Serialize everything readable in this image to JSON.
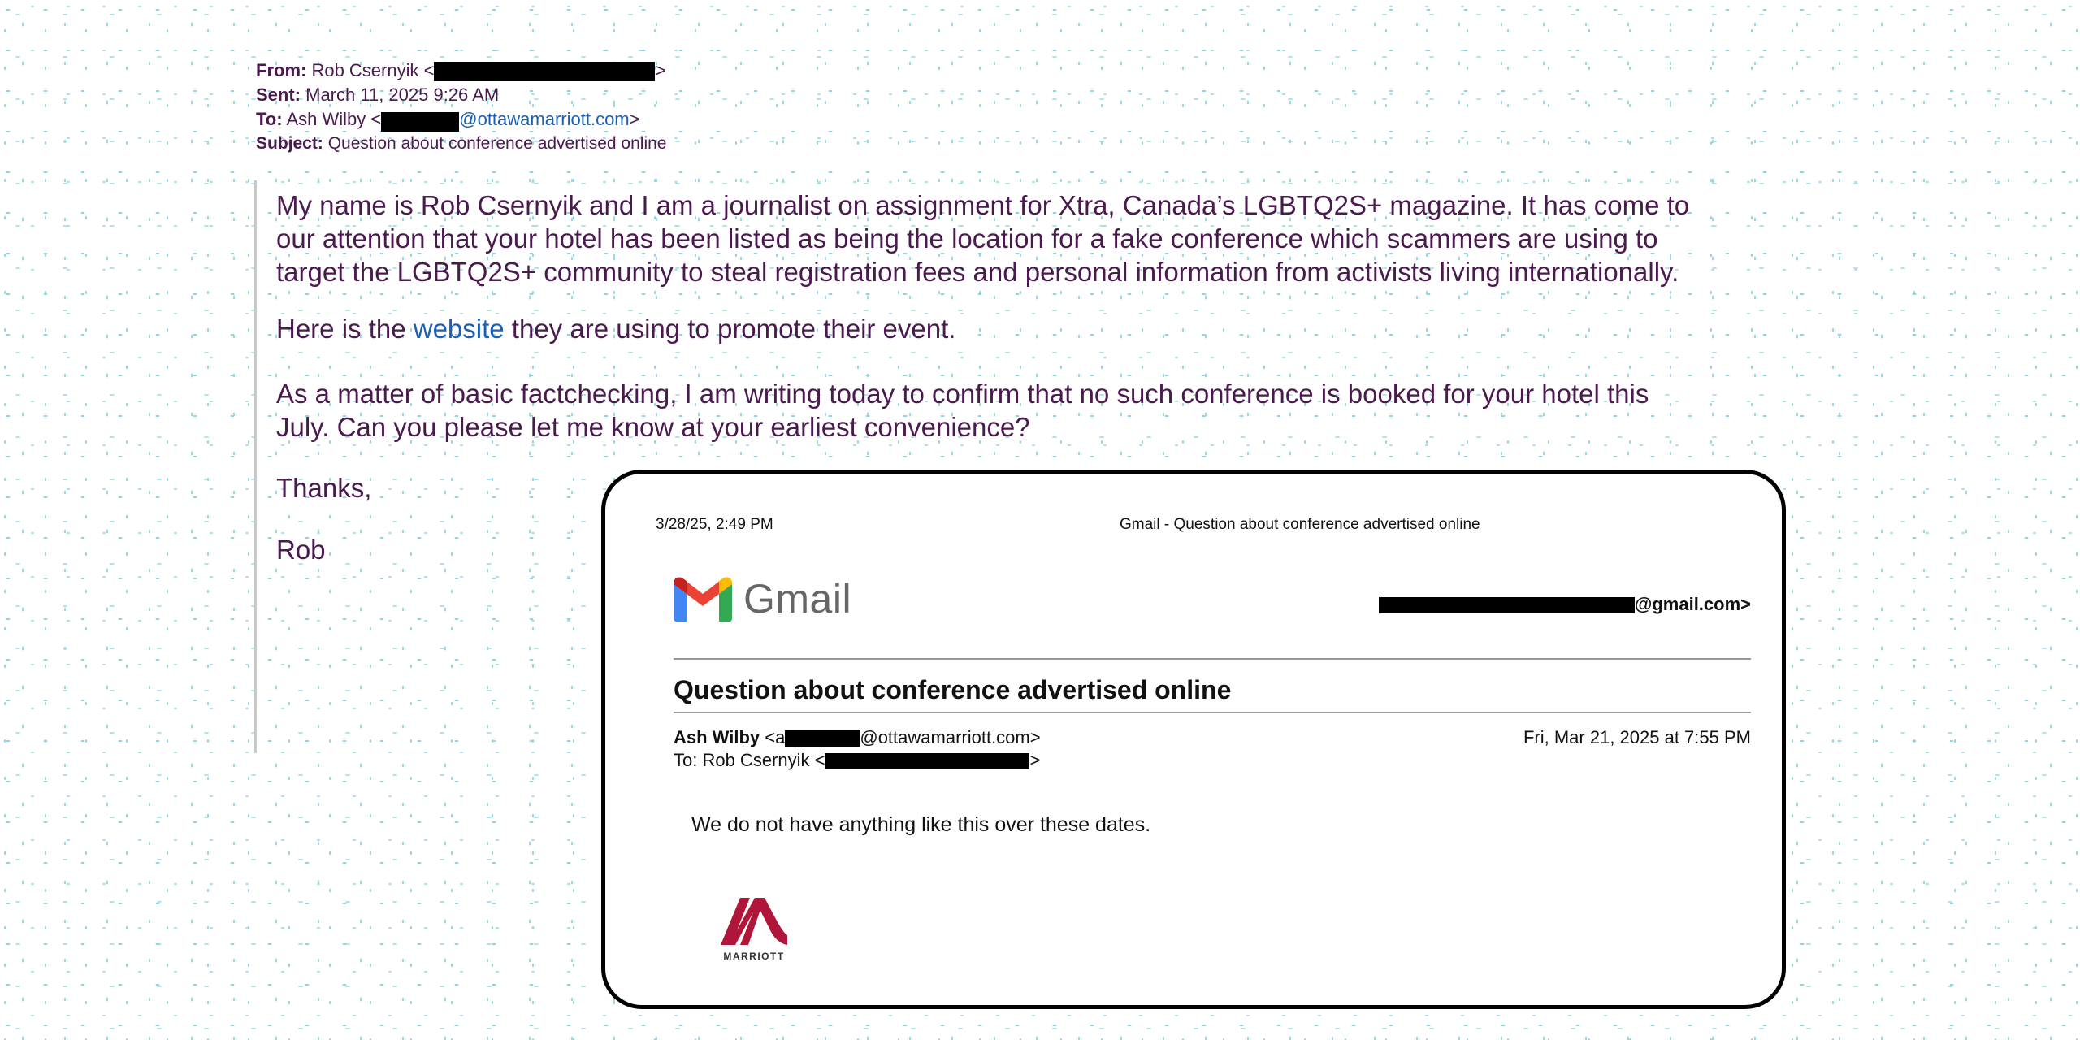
{
  "outer_email": {
    "from_label": "From:",
    "from_name": "Rob Csernyik <",
    "from_close": ">",
    "sent_label": "Sent:",
    "sent_value": "March 11, 2025 9:26 AM",
    "to_label": "To:",
    "to_name": "Ash Wilby <",
    "to_email_suffix": "@ottawamarriott.com",
    "to_close": ">",
    "subject_label": "Subject:",
    "subject_value": "Question about conference advertised online",
    "body": {
      "p1_line1": "My name is Rob Csernyik and I am a journalist on assignment for Xtra, Canada’s LGBTQ2S+ magazine. It has come to",
      "p1_line2": "our attention that your hotel has been listed as being the location for a fake conference which scammers are using to",
      "p1_line3": "target the LGBTQ2S+ community to steal registration fees and personal information from activists living internationally.",
      "p2_before": "Here is the ",
      "p2_link": "website",
      "p2_after": " they are using to promote their event.",
      "p3_line1": "As a matter of basic factchecking, I am writing today to confirm that no such conference is booked for your hotel this",
      "p3_line2": "July. Can you please let me know at your earliest convenience?",
      "thanks": "Thanks,",
      "signature": "Rob"
    }
  },
  "gmail_print": {
    "timestamp": "3/28/25, 2:49 PM",
    "page_title": "Gmail - Question about conference advertised online",
    "logo_text": "Gmail",
    "account_suffix": "@gmail.com>",
    "subject": "Question about conference advertised online",
    "sender_name": "Ash Wilby",
    "sender_open": " <a",
    "sender_suffix": "@ottawamarriott.com>",
    "date": "Fri, Mar 21, 2025 at 7:55 PM",
    "to_prefix": "To: Rob Csernyik <",
    "to_suffix": ">",
    "message": "We do not have anything like this over these dates.",
    "signature_logo_text": "MARRIOTT"
  },
  "colors": {
    "body_text": "#4a1a4f",
    "link": "#1a5fb4",
    "marriott_red": "#b0163a"
  },
  "icons": [
    "gmail-m-icon",
    "marriott-logo-icon"
  ]
}
